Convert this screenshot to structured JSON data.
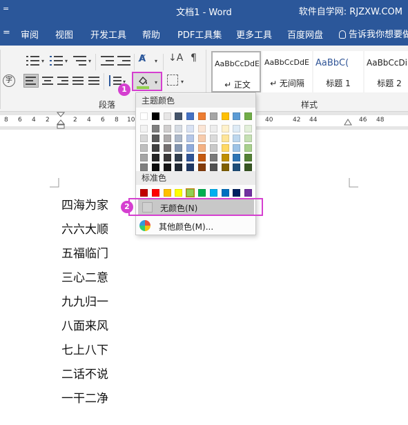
{
  "window": {
    "quick_access": "=",
    "title": "文档1  -  Word",
    "site_label": "软件自学网: RJZXW.COM"
  },
  "tabs": [
    {
      "label": "="
    },
    {
      "label": "审阅"
    },
    {
      "label": "视图"
    },
    {
      "label": "开发工具"
    },
    {
      "label": "帮助"
    },
    {
      "label": "PDF工具集"
    },
    {
      "label": "更多工具"
    },
    {
      "label": "百度网盘"
    }
  ],
  "tell_me": "告诉我你想要做",
  "ribbon": {
    "paragraph_group_label": "段落",
    "styles_group_label": "样式",
    "styles": [
      {
        "sample": "AaBbCcDdE",
        "name": "↵ 正文"
      },
      {
        "sample": "AaBbCcDdE",
        "name": "↵ 无间隔"
      },
      {
        "sample": "AaBbC(",
        "name": "标题 1"
      },
      {
        "sample": "AaBbCcDi",
        "name": "标题 2"
      }
    ],
    "shading_bar_color": "#92d050"
  },
  "ruler": {
    "numbers": [
      "8",
      "6",
      "4",
      "2",
      "2",
      "4",
      "6",
      "8",
      "10",
      "40",
      "42",
      "44",
      "46",
      "48"
    ]
  },
  "shading_menu": {
    "theme_colors_label": "主题颜色",
    "standard_colors_label": "标准色",
    "no_color_label": "无颜色(N)",
    "more_colors_label": "其他颜色(M)...",
    "theme_colors": [
      [
        "#ffffff",
        "#000000",
        "#e7e6e6",
        "#44546a",
        "#4472c4",
        "#ed7d31",
        "#a5a5a5",
        "#ffc000",
        "#5b9bd5",
        "#70ad47"
      ],
      [
        "#f2f2f2",
        "#7f7f7f",
        "#d0cece",
        "#d6dce4",
        "#d9e2f3",
        "#fbe5d5",
        "#ededed",
        "#fff2cc",
        "#deebf6",
        "#e2efd9"
      ],
      [
        "#d8d8d8",
        "#595959",
        "#aeabab",
        "#adb9ca",
        "#b4c6e7",
        "#f7cbac",
        "#dbdbdb",
        "#fee599",
        "#bdd7ee",
        "#c5e0b3"
      ],
      [
        "#bfbfbf",
        "#3f3f3f",
        "#757070",
        "#8496b0",
        "#8eaadb",
        "#f4b183",
        "#c9c9c9",
        "#ffd965",
        "#9dc3e6",
        "#a8d08d"
      ],
      [
        "#a5a5a5",
        "#262626",
        "#3a3838",
        "#323f4f",
        "#2f5496",
        "#c55a11",
        "#7b7b7b",
        "#bf8f00",
        "#2e75b5",
        "#538135"
      ],
      [
        "#7f7f7f",
        "#0c0c0c",
        "#171616",
        "#222a35",
        "#1f3864",
        "#833c0b",
        "#525252",
        "#7f6000",
        "#1e4e79",
        "#375623"
      ]
    ],
    "standard_colors": [
      "#c00000",
      "#ff0000",
      "#ffc000",
      "#ffff00",
      "#92d050",
      "#00b050",
      "#00b0f0",
      "#0070c0",
      "#002060",
      "#7030a0"
    ]
  },
  "callouts": [
    "1",
    "2"
  ],
  "document": {
    "paragraphs": [
      "四海为家",
      "六六大顺",
      "五福临门",
      "三心二意",
      "九九归一",
      "八面来风",
      "七上八下",
      "二话不说",
      "一干二净"
    ]
  }
}
